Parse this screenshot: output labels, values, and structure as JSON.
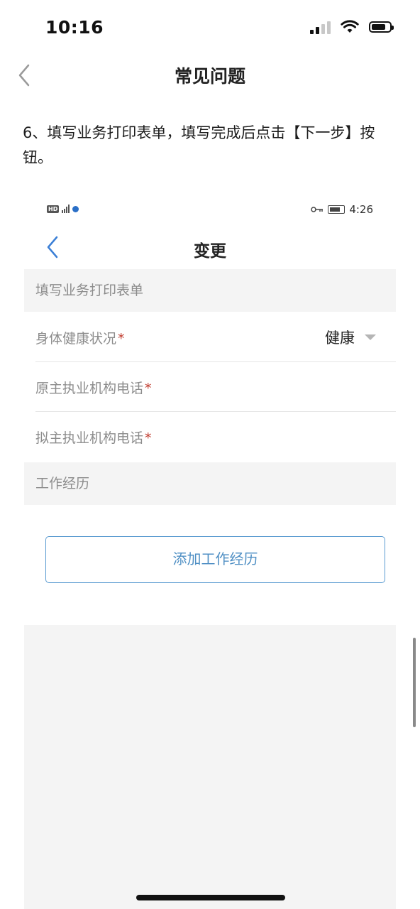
{
  "status_bar": {
    "time": "10:16"
  },
  "nav": {
    "title": "常见问题"
  },
  "instruction": {
    "text": "6、填写业务打印表单，填写完成后点击【下一步】按钮。"
  },
  "embedded": {
    "status": {
      "time": "4:26"
    },
    "nav": {
      "title": "变更"
    },
    "form_section_title": "填写业务打印表单",
    "fields": [
      {
        "label": "身体健康状况",
        "required_mark": "*",
        "value": "健康"
      },
      {
        "label": "原主执业机构电话",
        "required_mark": "*"
      },
      {
        "label": "拟主执业机构电话",
        "required_mark": "*"
      }
    ],
    "work_section_title": "工作经历",
    "add_button_label": "添加工作经历"
  },
  "colors": {
    "accent_blue": "#4f8fc4",
    "required_red": "#c0392b",
    "section_bg": "#f4f4f4"
  }
}
